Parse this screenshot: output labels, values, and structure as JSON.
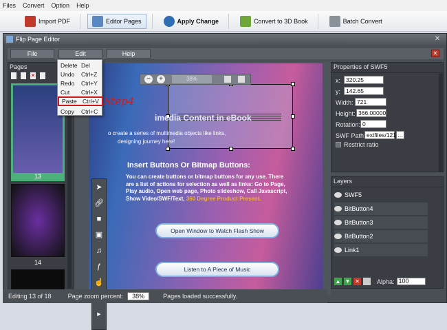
{
  "app_menu": [
    "Files",
    "Convert",
    "Option",
    "Help"
  ],
  "toolbar": [
    {
      "label": "Import PDF",
      "icon": "import-pdf-icon"
    },
    {
      "label": "Editor Pages",
      "icon": "editor-pages-icon"
    },
    {
      "label": "Apply Change",
      "icon": "apply-change-icon"
    },
    {
      "label": "Convert to 3D Book",
      "icon": "convert-3d-icon"
    },
    {
      "label": "Batch Convert",
      "icon": "batch-convert-icon"
    }
  ],
  "dialog": {
    "title": "Flip Page Editor",
    "menu": [
      "File",
      "Edit",
      "Help"
    ]
  },
  "edit_menu": [
    {
      "label": "Delete",
      "shortcut": "Del"
    },
    {
      "label": "Undo",
      "shortcut": "Ctrl+Z"
    },
    {
      "label": "Redo",
      "shortcut": "Ctrl+Y"
    },
    {
      "label": "Cut",
      "shortcut": "Ctrl+X"
    },
    {
      "label": "Paste",
      "shortcut": "Ctrl+V"
    },
    {
      "label": "Copy",
      "shortcut": "Ctrl+C"
    }
  ],
  "annotation": "Step4",
  "pages": {
    "header": "Pages",
    "thumbs": [
      "13",
      "14"
    ]
  },
  "zoom": "38%",
  "page_content": {
    "heading": "imedia Content in eBook",
    "intro_line1": "o create  a  series  of  multimedia objects like links,",
    "intro_line2": "designing journey  here!",
    "section_title": "Insert Buttons Or Bitmap Buttons:",
    "body": "You can create buttons or bitmap buttons for any use. There are a list of actions for selection as well as links:  Go to Page, Play audio, Open web page, Photo slideshow, Call Javascript, Show Video/SWF/Text,",
    "highlight": "360 Degree Product Present.",
    "button1": "Open Window to Watch Flash Show",
    "button2": "Listen to A Piece of Music"
  },
  "properties": {
    "title": "Properties of SWF5",
    "x_label": "x:",
    "x": "320.25",
    "y_label": "y:",
    "y": "142.65",
    "width_label": "Width:",
    "width": "721",
    "height_label": "Height:",
    "height": "366.00000",
    "rotation_label": "Rotation:",
    "rotation": "0",
    "swf_path_label": "SWF Path:",
    "swf_path": "extfiles/121",
    "browse": "...",
    "restrict_label": "Restrict ratio"
  },
  "layers": {
    "title": "Layers",
    "items": [
      "SWF5",
      "BitButton4",
      "BitButton3",
      "BitButton2",
      "Link1"
    ],
    "alpha_label": "Alpha:",
    "alpha": "100"
  },
  "status": {
    "editing": "Editing 13 of 18",
    "zoom_label": "Page zoom percent:",
    "zoom_value": "38%",
    "message": "Pages loaded successfully."
  }
}
